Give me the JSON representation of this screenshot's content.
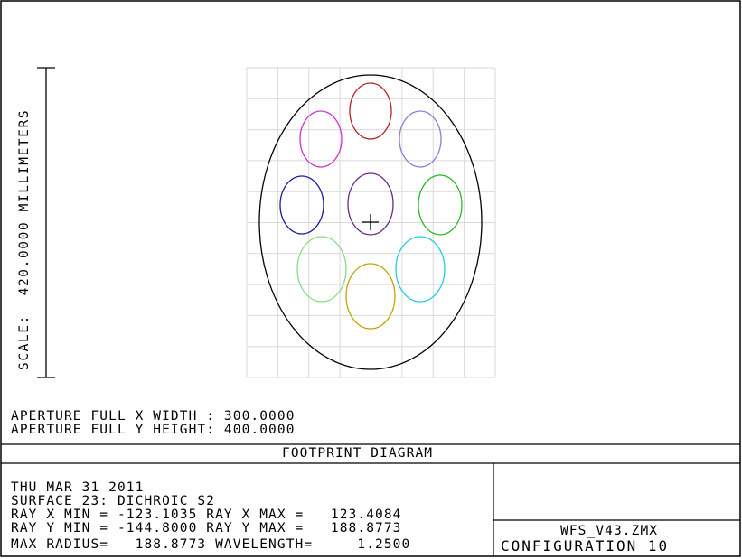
{
  "scale": {
    "label": "SCALE:  420.0000 MILLIMETERS"
  },
  "aperture": {
    "x_line": "APERTURE FULL X WIDTH : 300.0000",
    "y_line": "APERTURE FULL Y HEIGHT: 400.0000"
  },
  "title": "FOOTPRINT DIAGRAM",
  "info": {
    "date": "THU MAR 31 2011",
    "surface": "SURFACE 23: DICHROIC S2",
    "ray_x": "RAY X MIN = -123.1035 RAY X MAX =   123.4084",
    "ray_y": "RAY Y MIN = -144.8000 RAY Y MAX =   188.8773",
    "radius": "MAX RADIUS=   188.8773 WAVELENGTH=     1.2500"
  },
  "file": {
    "name": "WFS_V43.ZMX",
    "config": "CONFIGURATION 10"
  },
  "footprints": [
    {
      "name": "top",
      "color": "#b22222"
    },
    {
      "name": "upper-left",
      "color": "#cc33cc"
    },
    {
      "name": "upper-right",
      "color": "#8a7fd6"
    },
    {
      "name": "mid-left",
      "color": "#1a1aa0"
    },
    {
      "name": "center",
      "color": "#6a2a8a"
    },
    {
      "name": "mid-right",
      "color": "#22bb22"
    },
    {
      "name": "lower-left",
      "color": "#88dd88"
    },
    {
      "name": "lower-right",
      "color": "#22ccdd"
    },
    {
      "name": "bottom",
      "color": "#c8a200"
    }
  ],
  "aperture_color": "#000000",
  "grid_color": "#d9d9d9"
}
